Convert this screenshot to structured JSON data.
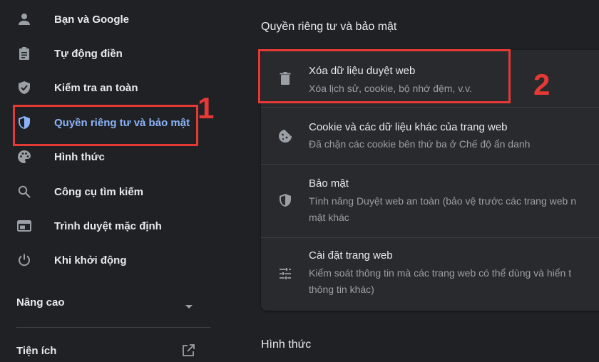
{
  "sidebar": {
    "items": [
      {
        "label": "Bạn và Google",
        "icon": "person-icon"
      },
      {
        "label": "Tự động điền",
        "icon": "clipboard-icon"
      },
      {
        "label": "Kiểm tra an toàn",
        "icon": "shield-check-icon"
      },
      {
        "label": "Quyền riêng tư và bảo mật",
        "icon": "privacy-shield-icon",
        "active": true
      },
      {
        "label": "Hình thức",
        "icon": "palette-icon"
      },
      {
        "label": "Công cụ tìm kiếm",
        "icon": "search-icon"
      },
      {
        "label": "Trình duyệt mặc định",
        "icon": "browser-icon"
      },
      {
        "label": "Khi khởi động",
        "icon": "power-icon"
      }
    ],
    "advanced_label": "Nâng cao",
    "extensions_label": "Tiện ích"
  },
  "main": {
    "section_title": "Quyền riêng tư và bảo mật",
    "rows": [
      {
        "title": "Xóa dữ liệu duyệt web",
        "subtitle": [
          "Xóa lịch sử, cookie, bộ nhớ đệm, v.v."
        ],
        "icon": "trash-icon"
      },
      {
        "title": "Cookie và các dữ liệu khác của trang web",
        "subtitle": [
          "Đã chặn các cookie bên thứ ba ở Chế độ ẩn danh"
        ],
        "icon": "cookie-icon"
      },
      {
        "title": "Bảo mật",
        "subtitle": [
          "Tính năng Duyệt web an toàn (bảo vệ trước các trang web n",
          "mật khác"
        ],
        "icon": "security-shield-icon"
      },
      {
        "title": "Cài đặt trang web",
        "subtitle": [
          "Kiểm soát thông tin mà các trang web có thể dùng và hiển t",
          "thông tin khác)"
        ],
        "icon": "tune-icon"
      }
    ],
    "next_section_title": "Hình thức"
  },
  "annotations": {
    "step1": "1",
    "step2": "2"
  },
  "colors": {
    "background": "#202124",
    "card": "#292a2d",
    "accent": "#8ab4f8",
    "highlight": "#e53935",
    "icon": "#9aa0a6"
  }
}
